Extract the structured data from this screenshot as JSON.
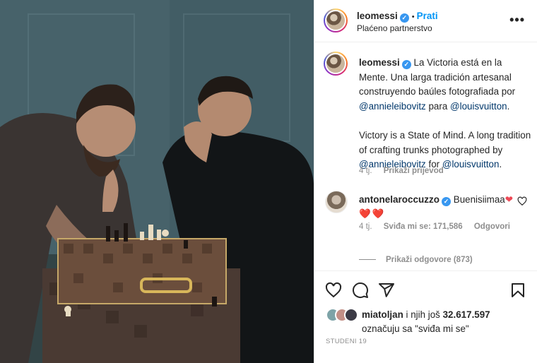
{
  "post": {
    "username": "leomessi",
    "follow_label": "Prati",
    "separator": "•",
    "subtitle": "Plaćeno partnerstvo",
    "more_label": "•••"
  },
  "caption": {
    "username": "leomessi",
    "es_text": "La Victoria está en la Mente. Una larga tradición artesanal construyendo baúles fotografiada por",
    "mention_photographer": "@annieleibovitz",
    "para": "para",
    "mention_brand": "@louisvuitton",
    "period": ".",
    "en_text": "Victory is a State of Mind. A long tradition of crafting trunks photographed by",
    "for": "for",
    "time": "4 tj.",
    "translate_label": "Prikaži prijevod"
  },
  "comment": {
    "username": "antonelaroccuzzo",
    "text": "Buenisiimaa",
    "hearts_line": "❤️❤️",
    "time": "4 tj.",
    "likes": "Sviđa mi se: 171,586",
    "reply_label": "Odgovori",
    "view_replies": "Prikaži odgovore (873)"
  },
  "likes": {
    "user": "miatoljan",
    "rest": " i njih još ",
    "count": "32.617.597",
    "line2": "označuju sa \"sviđa mi se\""
  },
  "date": "STUDENI 19",
  "colors": {
    "link": "#00376b",
    "follow": "#0095f6",
    "verified": "#3897f0",
    "muted": "#8e8e8e",
    "heart": "#ed4956"
  },
  "icons": [
    "verified-badge-icon",
    "heart-icon",
    "comment-icon",
    "share-icon",
    "bookmark-icon",
    "more-icon"
  ]
}
